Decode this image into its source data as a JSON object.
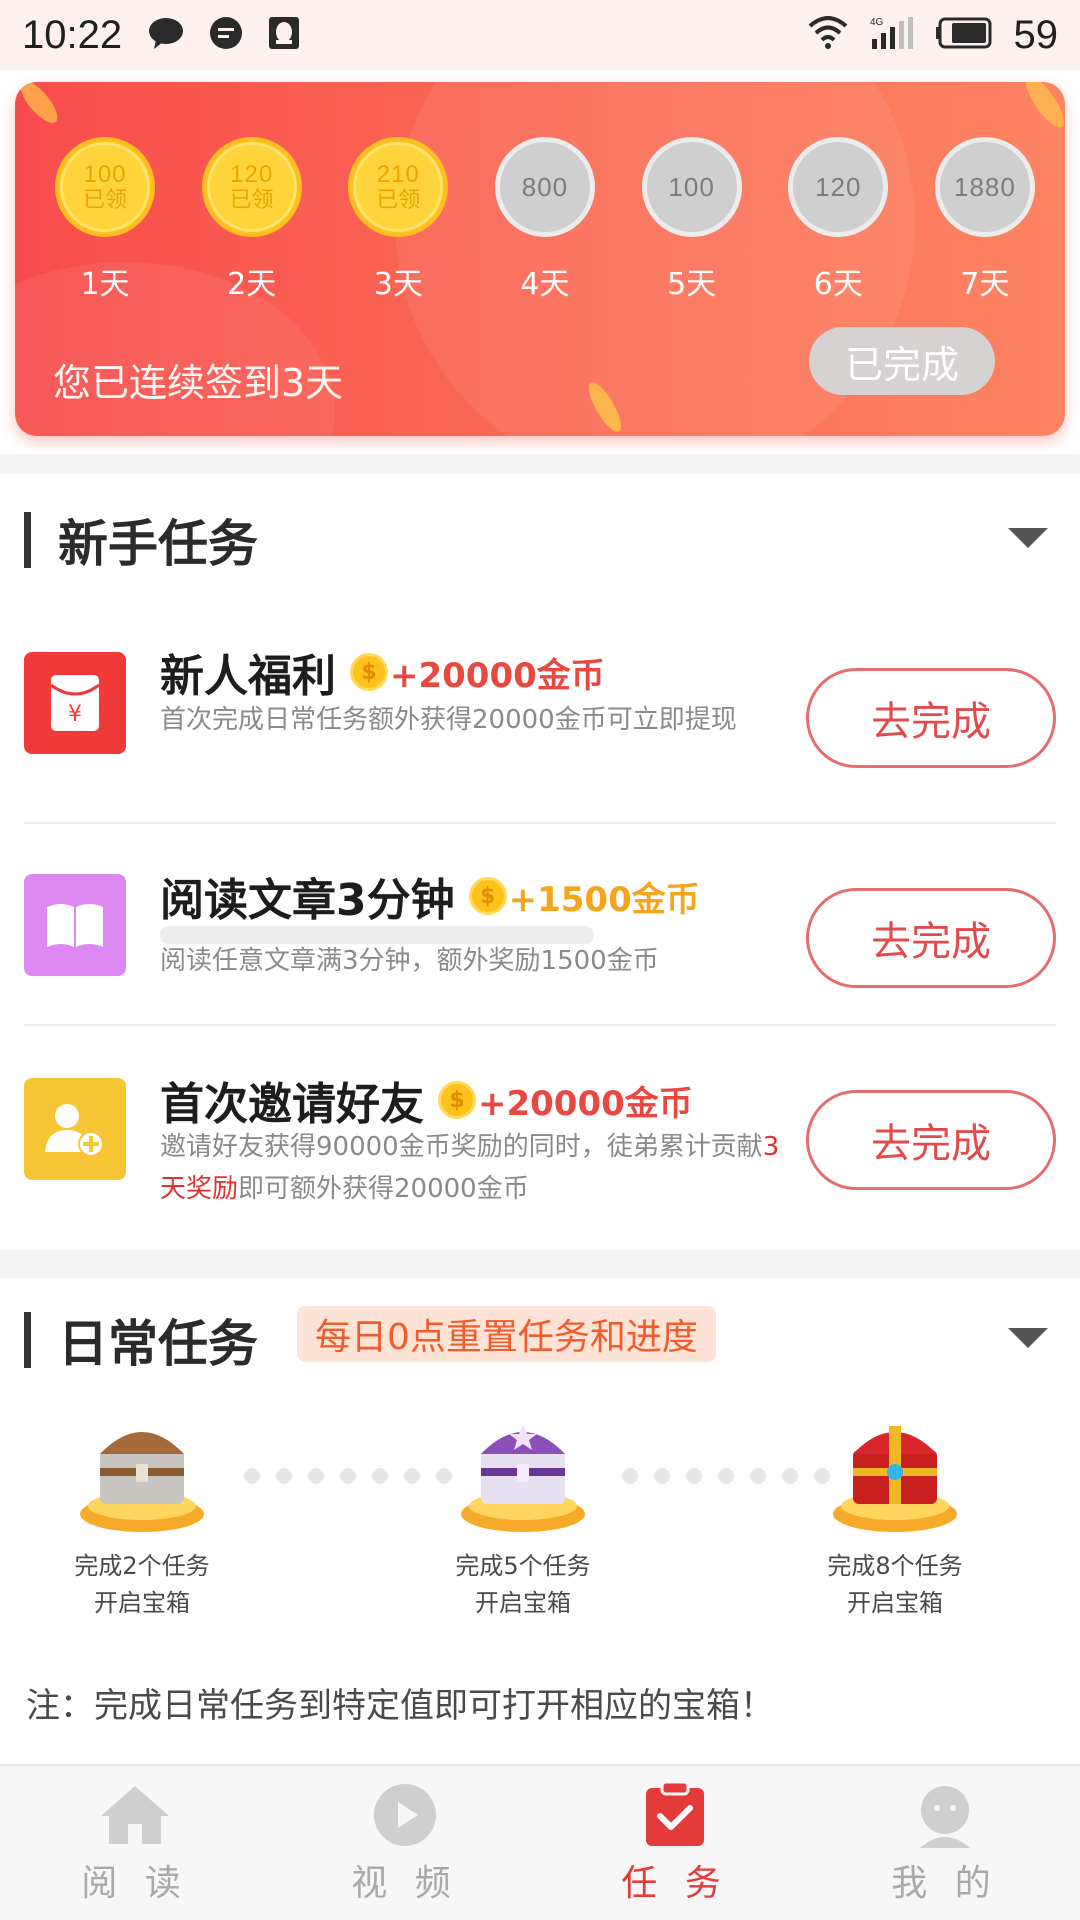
{
  "status_bar": {
    "time": "10:22",
    "battery": "59",
    "network": "4G"
  },
  "signin": {
    "days": [
      {
        "amount": "100",
        "status": "已领",
        "label": "1天",
        "claimed": true
      },
      {
        "amount": "120",
        "status": "已领",
        "label": "2天",
        "claimed": true
      },
      {
        "amount": "210",
        "status": "已领",
        "label": "3天",
        "claimed": true
      },
      {
        "amount": "800",
        "status": "",
        "label": "4天",
        "claimed": false
      },
      {
        "amount": "100",
        "status": "",
        "label": "5天",
        "claimed": false
      },
      {
        "amount": "120",
        "status": "",
        "label": "6天",
        "claimed": false
      },
      {
        "amount": "1880",
        "status": "",
        "label": "7天",
        "claimed": false
      }
    ],
    "message": "您已连续签到3天",
    "button_label": "已完成"
  },
  "newbie": {
    "title": "新手任务",
    "tasks": [
      {
        "title": "新人福利",
        "reward": "+20000金币",
        "desc": "首次完成日常任务额外获得20000金币可立即提现",
        "button": "去完成"
      },
      {
        "title": "阅读文章3分钟",
        "reward": "+1500金币",
        "desc": "阅读任意文章满3分钟，额外奖励1500金币",
        "button": "去完成"
      },
      {
        "title": "首次邀请好友",
        "reward": "+20000金币",
        "desc_part1": "邀请好友获得90000金币奖励的同时，徒弟累计贡献",
        "desc_highlight": "3天奖励",
        "desc_part2": "即可额外获得20000金币",
        "button": "去完成"
      }
    ]
  },
  "daily": {
    "title": "日常任务",
    "badge": "每日0点重置任务和进度",
    "chests": [
      {
        "line1": "完成2个任务",
        "line2": "开启宝箱"
      },
      {
        "line1": "完成5个任务",
        "line2": "开启宝箱"
      },
      {
        "line1": "完成8个任务",
        "line2": "开启宝箱"
      }
    ],
    "note": "注：完成日常任务到特定值即可打开相应的宝箱！"
  },
  "nav": {
    "items": [
      {
        "label": "阅 读",
        "icon": "home-icon"
      },
      {
        "label": "视 频",
        "icon": "play-icon"
      },
      {
        "label": "任 务",
        "icon": "task-icon"
      },
      {
        "label": "我 的",
        "icon": "profile-icon"
      }
    ],
    "active_index": 2
  },
  "colors": {
    "accent": "#e53a3a",
    "card_start": "#f84c4c",
    "card_end": "#fd8463",
    "gold": "#ffd43b"
  }
}
